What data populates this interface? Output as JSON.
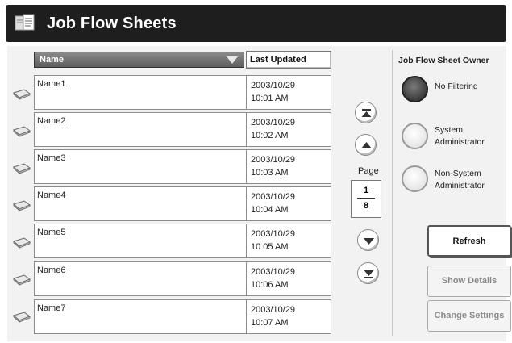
{
  "header": {
    "title": "Job Flow Sheets"
  },
  "columns": {
    "name": "Name",
    "last_updated": "Last Updated"
  },
  "rows": [
    {
      "name": "Name1",
      "date": "2003/10/29",
      "time": "10:01 AM"
    },
    {
      "name": "Name2",
      "date": "2003/10/29",
      "time": "10:02 AM"
    },
    {
      "name": "Name3",
      "date": "2003/10/29",
      "time": "10:03 AM"
    },
    {
      "name": "Name4",
      "date": "2003/10/29",
      "time": "10:04 AM"
    },
    {
      "name": "Name5",
      "date": "2003/10/29",
      "time": "10:05 AM"
    },
    {
      "name": "Name6",
      "date": "2003/10/29",
      "time": "10:06 AM"
    },
    {
      "name": "Name7",
      "date": "2003/10/29",
      "time": "10:07 AM"
    }
  ],
  "pager": {
    "label": "Page",
    "current": "1",
    "total": "8"
  },
  "owner": {
    "title": "Job Flow Sheet Owner",
    "options": [
      {
        "label": "No Filtering",
        "selected": true
      },
      {
        "label": "System\nAdministrator",
        "selected": false
      },
      {
        "label": "Non-System\nAdministrator",
        "selected": false
      }
    ]
  },
  "actions": {
    "refresh": "Refresh",
    "show_details": "Show Details",
    "change_settings": "Change Settings"
  },
  "icons": {
    "header": "job-flow-sheets-icon",
    "row": "job-flow-sheet-icon",
    "first": "first-page-icon",
    "prev": "previous-page-icon",
    "next": "next-page-icon",
    "last": "last-page-icon"
  },
  "colors": {
    "header_bg": "#1e1e1e",
    "selected_column": "#6e6e6e",
    "panel_bg": "#f2f2f2"
  }
}
